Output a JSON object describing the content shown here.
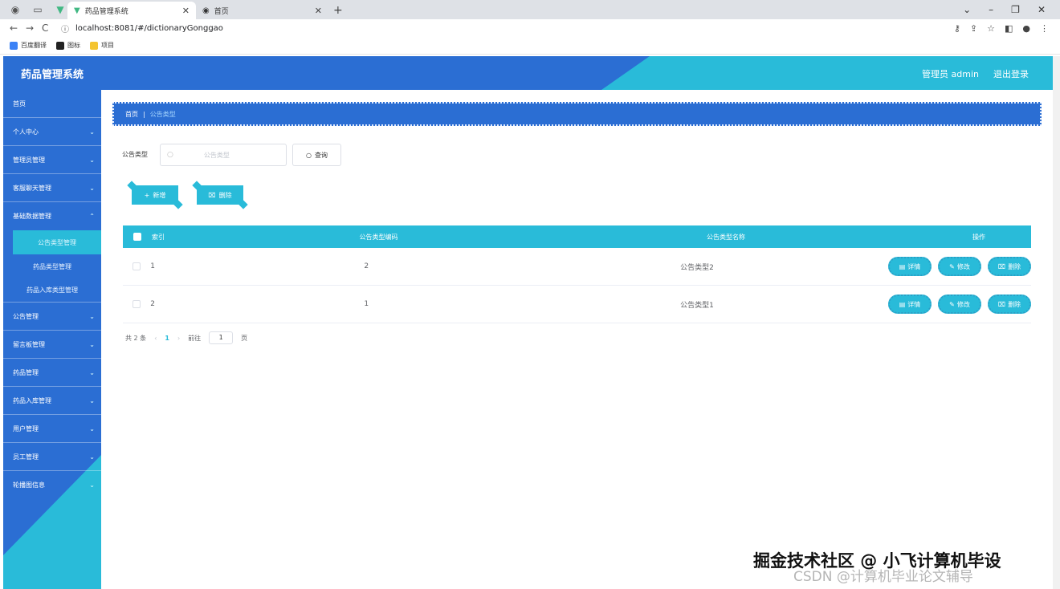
{
  "browser": {
    "tabs": [
      {
        "title": "药品管理系统",
        "active": true
      },
      {
        "title": "首页",
        "active": false
      }
    ],
    "url": "localhost:8081/#/dictionaryGonggao",
    "bookmarks": [
      "百度翻译",
      "图标",
      "项目"
    ]
  },
  "header": {
    "title": "药品管理系统",
    "user": "管理员 admin",
    "logout": "退出登录"
  },
  "sidebar": {
    "items": [
      {
        "label": "首页"
      },
      {
        "label": "个人中心"
      },
      {
        "label": "管理员管理"
      },
      {
        "label": "客服聊天管理"
      },
      {
        "label": "基础数据管理"
      }
    ],
    "sub_items": [
      {
        "label": "公告类型管理",
        "active": true
      },
      {
        "label": "药品类型管理"
      },
      {
        "label": "药品入库类型管理"
      }
    ],
    "items_after": [
      {
        "label": "公告管理"
      },
      {
        "label": "留言板管理"
      },
      {
        "label": "药品管理"
      },
      {
        "label": "药品入库管理"
      },
      {
        "label": "用户管理"
      },
      {
        "label": "员工管理"
      },
      {
        "label": "轮播图信息"
      }
    ]
  },
  "breadcrumb": {
    "home": "首页",
    "current": "公告类型"
  },
  "search": {
    "label": "公告类型",
    "placeholder": "公告类型",
    "button": "查询"
  },
  "actions": {
    "add": "新增",
    "delete": "删除"
  },
  "table": {
    "headers": [
      "索引",
      "公告类型编码",
      "公告类型名称",
      "操作"
    ],
    "rows": [
      {
        "index": "1",
        "code": "2",
        "name": "公告类型2"
      },
      {
        "index": "2",
        "code": "1",
        "name": "公告类型1"
      }
    ],
    "ops": {
      "detail": "详情",
      "edit": "修改",
      "delete": "删除"
    }
  },
  "pagination": {
    "total": "共 2 条",
    "page": "1",
    "goto": "前往",
    "goto_value": "1",
    "suffix": "页"
  },
  "watermark": {
    "main": "掘金技术社区 @ 小飞计算机毕设",
    "sub": "CSDN @计算机毕业论文辅导"
  },
  "colors": {
    "primary_blue": "#2b6ed3",
    "accent_cyan": "#29bbd9"
  }
}
